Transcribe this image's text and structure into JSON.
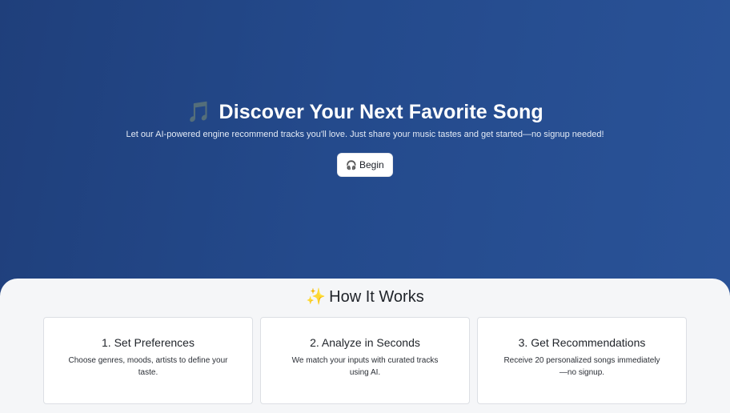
{
  "hero": {
    "title_emoji": "🎵",
    "title": "Discover Your Next Favorite Song",
    "subtitle": "Let our AI-powered engine recommend tracks you'll love. Just share your music tastes and get started—no signup needed!",
    "button_icon": "🎧",
    "button_label": "Begin"
  },
  "how_it_works": {
    "title_emoji": "✨",
    "title": "How It Works",
    "steps": [
      {
        "title": "1. Set Preferences",
        "text": "Choose genres, moods, artists to define your taste."
      },
      {
        "title": "2. Analyze in Seconds",
        "text": "We match your inputs with curated tracks using AI."
      },
      {
        "title": "3. Get Recommendations",
        "text": "Receive 20 personalized songs immediately—no signup."
      }
    ]
  },
  "colors": {
    "hero_gradient_start": "#1f3f7b",
    "hero_gradient_end": "#2a5398",
    "section_background": "#f5f6f8",
    "card_background": "#ffffff"
  }
}
